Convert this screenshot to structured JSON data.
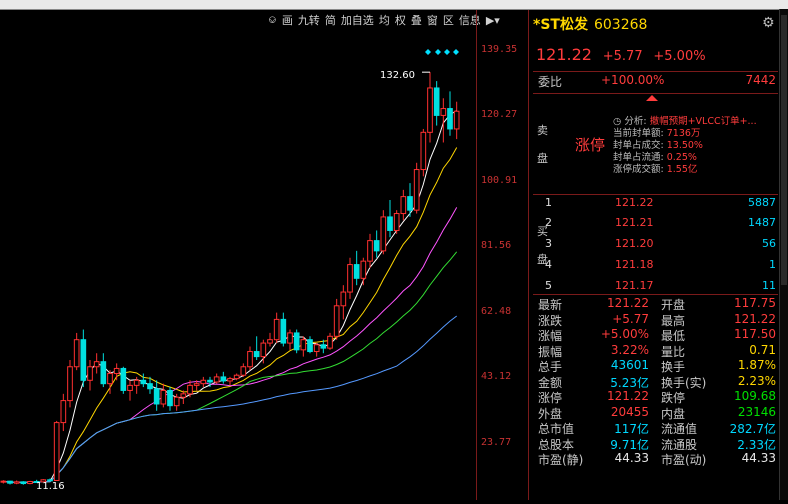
{
  "toolbar": {
    "items": [
      "画",
      "九转",
      "简",
      "加自选",
      "均",
      "权",
      "叠",
      "窗",
      "区",
      "信息"
    ],
    "icons": [
      "price-tag-icon",
      "play-icon",
      "dropdown-icon"
    ]
  },
  "chart": {
    "y_ticks": [
      "139.35",
      "120.27",
      "100.91",
      "81.56",
      "62.48",
      "43.12",
      "23.77"
    ],
    "high_label": "132.60",
    "low_label": "11.16"
  },
  "chart_data": {
    "type": "candlestick",
    "ylim": [
      11.16,
      139.35
    ],
    "annotations": [
      "132.60",
      "11.16"
    ],
    "candles": [
      [
        12.0,
        12.5,
        11.5,
        12.2
      ],
      [
        12.2,
        12.3,
        11.2,
        11.6
      ],
      [
        11.6,
        12.4,
        11.3,
        12.0
      ],
      [
        12.0,
        12.2,
        11.16,
        11.5
      ],
      [
        11.5,
        12.3,
        11.3,
        12.1
      ],
      [
        12.1,
        12.6,
        11.8,
        12.0
      ],
      [
        12.0,
        12.8,
        11.9,
        12.6
      ],
      [
        12.6,
        13.0,
        12.2,
        12.4
      ],
      [
        12.4,
        30.0,
        12.3,
        29.5
      ],
      [
        29.5,
        38.0,
        27.0,
        36.0
      ],
      [
        36.0,
        48.0,
        34.0,
        46.0
      ],
      [
        46.0,
        56.0,
        45.0,
        54.0
      ],
      [
        54.0,
        57.0,
        40.0,
        42.0
      ],
      [
        42.0,
        48.0,
        39.0,
        46.0
      ],
      [
        46.0,
        50.0,
        44.0,
        47.5
      ],
      [
        47.5,
        50.0,
        40.0,
        41.0
      ],
      [
        41.0,
        45.0,
        38.0,
        44.0
      ],
      [
        44.0,
        47.0,
        42.0,
        45.5
      ],
      [
        45.5,
        46.0,
        38.0,
        39.0
      ],
      [
        39.0,
        42.0,
        36.0,
        40.5
      ],
      [
        40.5,
        43.0,
        38.0,
        42.0
      ],
      [
        42.0,
        44.0,
        40.0,
        41.0
      ],
      [
        41.0,
        43.0,
        38.0,
        39.5
      ],
      [
        39.5,
        42.0,
        33.0,
        35.0
      ],
      [
        35.0,
        41.0,
        34.0,
        39.0
      ],
      [
        39.0,
        40.0,
        33.0,
        34.5
      ],
      [
        34.5,
        38.0,
        33.0,
        37.0
      ],
      [
        37.0,
        39.0,
        35.0,
        38.0
      ],
      [
        38.0,
        42.0,
        37.0,
        40.5
      ],
      [
        40.5,
        42.0,
        39.0,
        41.0
      ],
      [
        41.0,
        43.0,
        40.0,
        42.0
      ],
      [
        42.0,
        43.0,
        40.0,
        41.5
      ],
      [
        41.5,
        44.0,
        41.0,
        43.0
      ],
      [
        43.0,
        44.5,
        41.0,
        41.8
      ],
      [
        41.8,
        43.0,
        40.5,
        42.5
      ],
      [
        42.5,
        44.0,
        42.0,
        43.5
      ],
      [
        43.5,
        47.0,
        43.0,
        46.0
      ],
      [
        46.0,
        52.0,
        45.0,
        50.5
      ],
      [
        50.5,
        55.0,
        48.0,
        49.0
      ],
      [
        49.0,
        54.0,
        47.0,
        53.0
      ],
      [
        53.0,
        56.0,
        52.0,
        54.0
      ],
      [
        54.0,
        62.0,
        53.0,
        60.0
      ],
      [
        60.0,
        62.0,
        52.0,
        53.0
      ],
      [
        53.0,
        57.0,
        51.0,
        56.0
      ],
      [
        56.0,
        57.0,
        50.0,
        51.0
      ],
      [
        51.0,
        55.0,
        49.0,
        54.0
      ],
      [
        54.0,
        55.0,
        50.0,
        50.5
      ],
      [
        50.5,
        53.0,
        49.0,
        52.5
      ],
      [
        52.5,
        54.0,
        50.0,
        51.5
      ],
      [
        51.5,
        56.0,
        51.0,
        55.0
      ],
      [
        55.0,
        66.0,
        54.0,
        64.0
      ],
      [
        64.0,
        70.0,
        60.0,
        68.0
      ],
      [
        68.0,
        78.0,
        66.0,
        76.0
      ],
      [
        76.0,
        80.0,
        70.0,
        72.0
      ],
      [
        72.0,
        78.0,
        70.0,
        77.0
      ],
      [
        77.0,
        85.0,
        75.0,
        83.0
      ],
      [
        83.0,
        86.0,
        78.0,
        80.0
      ],
      [
        80.0,
        92.0,
        79.0,
        90.0
      ],
      [
        90.0,
        95.0,
        84.0,
        86.0
      ],
      [
        86.0,
        92.0,
        85.0,
        91.0
      ],
      [
        91.0,
        98.0,
        89.0,
        96.0
      ],
      [
        96.0,
        100.0,
        90.0,
        92.0
      ],
      [
        92.0,
        106.0,
        91.0,
        104.0
      ],
      [
        104.0,
        116.0,
        102.0,
        115.0
      ],
      [
        115.0,
        132.6,
        112.0,
        128.0
      ],
      [
        128.0,
        130.0,
        117.0,
        120.0
      ],
      [
        120.0,
        125.0,
        112.0,
        122.0
      ],
      [
        122.0,
        127.0,
        114.0,
        116.0
      ],
      [
        116.0,
        124.0,
        113.0,
        121.22
      ]
    ]
  },
  "stock": {
    "name": "*ST松发",
    "code": "603268",
    "price": "121.22",
    "change": "+5.77",
    "change_pct": "+5.00%"
  },
  "weibi": {
    "label": "委比",
    "value": "+100.00%",
    "volume": "7442"
  },
  "sell": {
    "label1": "卖",
    "label2": "盘",
    "limit_text": "涨停",
    "analysis_title": "分析:",
    "analysis_link": "撤帽预期+VLCC订单+...",
    "lines": [
      {
        "k": "当前封单额:",
        "v": "7136万"
      },
      {
        "k": "封单占成交:",
        "v": "13.50%"
      },
      {
        "k": "封单占流通:",
        "v": "0.25%"
      },
      {
        "k": "涨停成交额:",
        "v": "1.55亿"
      }
    ]
  },
  "buy": {
    "label1": "买",
    "label2": "盘",
    "rows": [
      {
        "level": "1",
        "price": "121.22",
        "vol": "5887"
      },
      {
        "level": "2",
        "price": "121.21",
        "vol": "1487"
      },
      {
        "level": "3",
        "price": "121.20",
        "vol": "56"
      },
      {
        "level": "4",
        "price": "121.18",
        "vol": "1"
      },
      {
        "level": "5",
        "price": "121.17",
        "vol": "11"
      }
    ]
  },
  "stats": [
    {
      "k1": "最新",
      "v1": "121.22",
      "c1": "red",
      "k2": "开盘",
      "v2": "117.75",
      "c2": "red"
    },
    {
      "k1": "涨跌",
      "v1": "+5.77",
      "c1": "red",
      "k2": "最高",
      "v2": "121.22",
      "c2": "red"
    },
    {
      "k1": "涨幅",
      "v1": "+5.00%",
      "c1": "red",
      "k2": "最低",
      "v2": "117.50",
      "c2": "red"
    },
    {
      "k1": "振幅",
      "v1": "3.22%",
      "c1": "red",
      "k2": "量比",
      "v2": "0.71",
      "c2": "yellow"
    },
    {
      "k1": "总手",
      "v1": "43601",
      "c1": "cyan",
      "k2": "换手",
      "v2": "1.87%",
      "c2": "yellow"
    },
    {
      "k1": "金额",
      "v1": "5.23亿",
      "c1": "cyan",
      "k2": "换手(实)",
      "v2": "2.23%",
      "c2": "yellow"
    },
    {
      "k1": "涨停",
      "v1": "121.22",
      "c1": "red",
      "k2": "跌停",
      "v2": "109.68",
      "c2": "green"
    },
    {
      "k1": "外盘",
      "v1": "20455",
      "c1": "red",
      "k2": "内盘",
      "v2": "23146",
      "c2": "green"
    },
    {
      "k1": "总市值",
      "v1": "117亿",
      "c1": "cyan",
      "k2": "流通值",
      "v2": "282.7亿",
      "c2": "cyan"
    },
    {
      "k1": "总股本",
      "v1": "9.71亿",
      "c1": "cyan",
      "k2": "流通股",
      "v2": "2.33亿",
      "c2": "cyan"
    },
    {
      "k1": "市盈(静)",
      "v1": "44.33",
      "c1": "white",
      "k2": "市盈(动)",
      "v2": "44.33",
      "c2": "white"
    }
  ]
}
